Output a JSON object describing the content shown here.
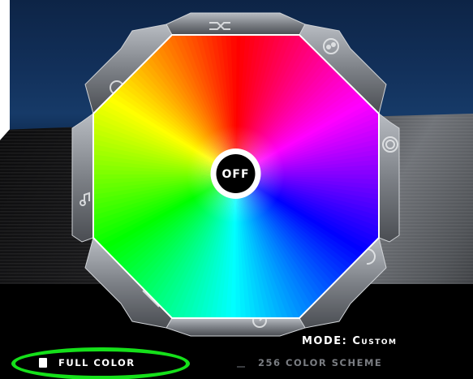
{
  "power_button": {
    "label": "OFF"
  },
  "mode": {
    "label": "MODE:",
    "value": "Custom"
  },
  "options": {
    "full_color": {
      "label": "FULL COLOR",
      "selected": true
    },
    "color_scheme": {
      "label": "256 COLOR SCHEME",
      "selected": false
    }
  },
  "tab_icons": [
    "shuffle-icon",
    "dots-icon",
    "wave-icon",
    "rings-icon",
    "loop-icon",
    "speed-icon",
    "keyboard-icon",
    "music-icon"
  ],
  "colors": {
    "highlight": "#15e01a",
    "background_blue": "#12305a"
  }
}
